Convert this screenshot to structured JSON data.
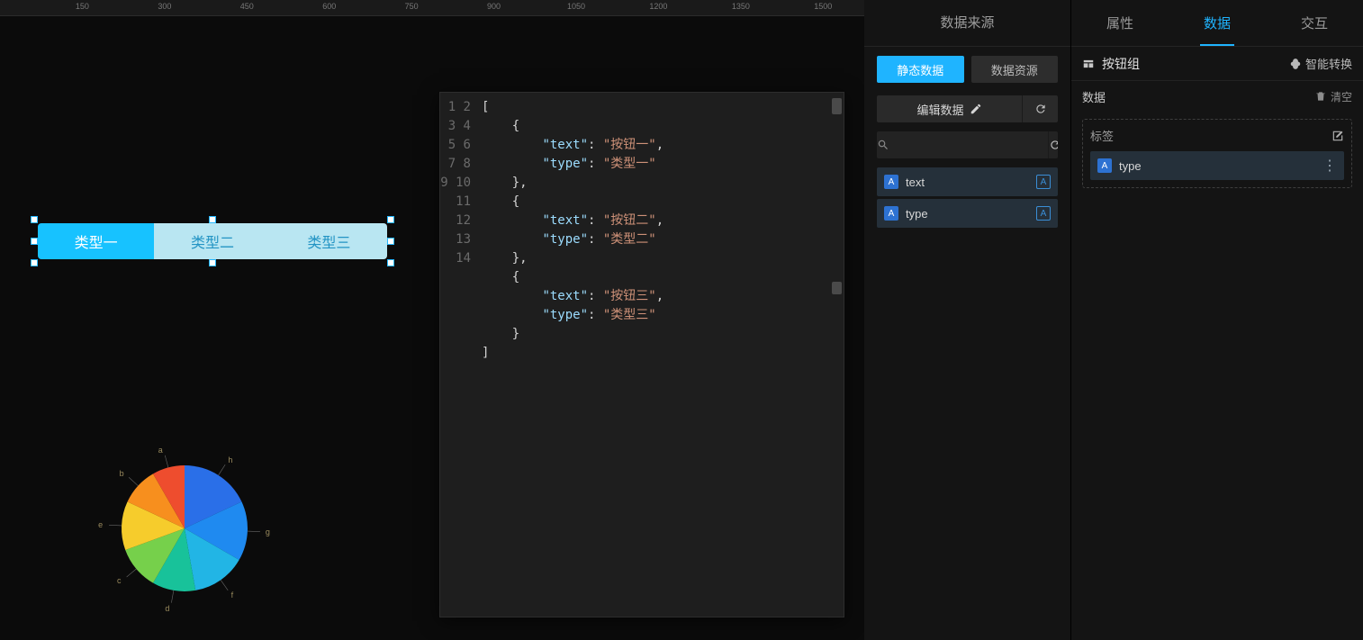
{
  "ruler": {
    "ticks": [
      150,
      300,
      450,
      600,
      750,
      900,
      1050,
      1200,
      1350,
      1500
    ]
  },
  "canvas": {
    "button_group": {
      "buttons": [
        {
          "label": "类型一",
          "active": true
        },
        {
          "label": "类型二",
          "active": false
        },
        {
          "label": "类型三",
          "active": false
        }
      ]
    },
    "pie": {
      "labels": [
        "a",
        "b",
        "c",
        "d",
        "e",
        "f",
        "g",
        "h"
      ],
      "slices": [
        {
          "label": "h",
          "color": "#2a6fe8",
          "angle": 65
        },
        {
          "label": "g",
          "color": "#1f8af0",
          "angle": 55
        },
        {
          "label": "f",
          "color": "#22b5e5",
          "angle": 50
        },
        {
          "label": "d",
          "color": "#18c29a",
          "angle": 40
        },
        {
          "label": "c",
          "color": "#76d04b",
          "angle": 40
        },
        {
          "label": "e",
          "color": "#f6cc2c",
          "angle": 45
        },
        {
          "label": "b",
          "color": "#f78f1e",
          "angle": 35
        },
        {
          "label": "a",
          "color": "#ee4d2e",
          "angle": 30
        }
      ]
    }
  },
  "editor": {
    "lines": 14,
    "json": [
      {
        "text": "按钮一",
        "type": "类型一"
      },
      {
        "text": "按钮二",
        "type": "类型二"
      },
      {
        "text": "按钮三",
        "type": "类型三"
      }
    ]
  },
  "ds_panel": {
    "title": "数据来源",
    "tabs": {
      "static": "静态数据",
      "resource": "数据资源"
    },
    "edit_label": "编辑数据",
    "search_placeholder": "",
    "fields": [
      {
        "icon": "A",
        "name": "text"
      },
      {
        "icon": "A",
        "name": "type"
      }
    ],
    "badge": "A"
  },
  "inspector": {
    "tabs": {
      "attr": "属性",
      "data": "数据",
      "interact": "交互",
      "active": "data"
    },
    "component_name": "按钮组",
    "smart_convert": "智能转换",
    "section_label": "数据",
    "clear_label": "清空",
    "dropzone": {
      "title": "标签",
      "items": [
        {
          "icon": "A",
          "name": "type"
        }
      ]
    }
  }
}
